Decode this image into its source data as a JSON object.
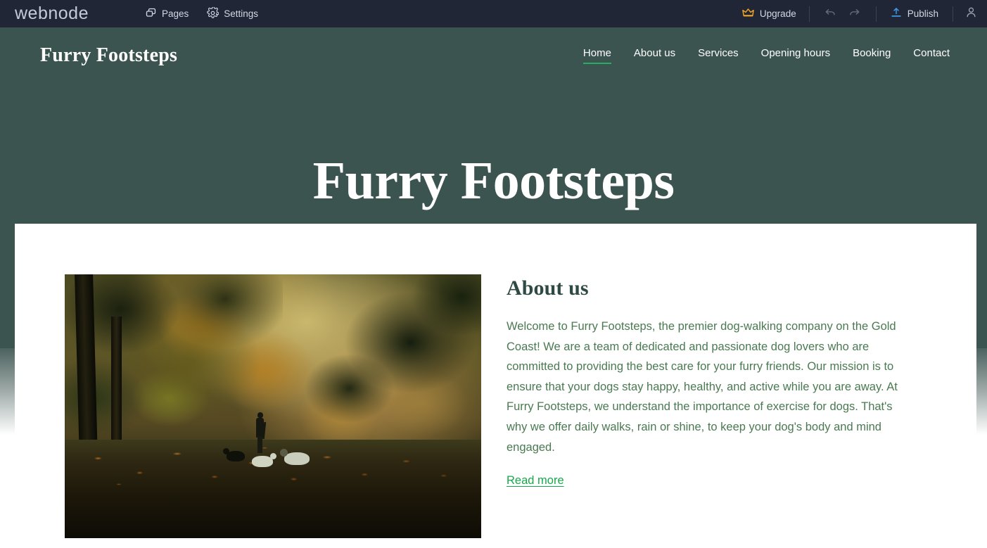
{
  "editor": {
    "brand": "webnode",
    "nav": [
      {
        "label": "Pages",
        "icon": "pages-icon"
      },
      {
        "label": "Settings",
        "icon": "gear-icon"
      }
    ],
    "upgrade_label": "Upgrade",
    "publish_label": "Publish",
    "undo_icon": "undo-arrow-icon",
    "redo_icon": "redo-arrow-icon",
    "account_icon": "user-account-icon",
    "colors": {
      "bar_bg": "#212636",
      "bar_text": "#d2d8e3",
      "upgrade_accent": "#f5a623",
      "publish_accent": "#3c9ae8"
    }
  },
  "site": {
    "logo": "Furry Footsteps",
    "nav": [
      {
        "label": "Home",
        "active": true
      },
      {
        "label": "About us",
        "active": false
      },
      {
        "label": "Services",
        "active": false
      },
      {
        "label": "Opening hours",
        "active": false
      },
      {
        "label": "Booking",
        "active": false
      },
      {
        "label": "Contact",
        "active": false
      }
    ],
    "hero_title": "Furry Footsteps",
    "colors": {
      "hero_bg": "#3c5450",
      "nav_active_underline": "#27ae60",
      "heading": "#2f4a44",
      "body_text": "#4a7a52",
      "link": "#17a84b"
    },
    "about": {
      "heading": "About us",
      "paragraph": "Welcome to Furry Footsteps, the premier dog-walking company on the Gold Coast! We are a team of dedicated and passionate dog lovers who are committed to providing the best care for your furry friends. Our mission is to ensure that your dogs stay happy, healthy, and active while you are away. At Furry Footsteps, we understand the importance of exercise for dogs. That's why we offer daily walks, rain or shine, to keep your dog's body and mind engaged.",
      "read_more": "Read more",
      "image_alt": "autumn-park-dog-walker-photo"
    }
  }
}
